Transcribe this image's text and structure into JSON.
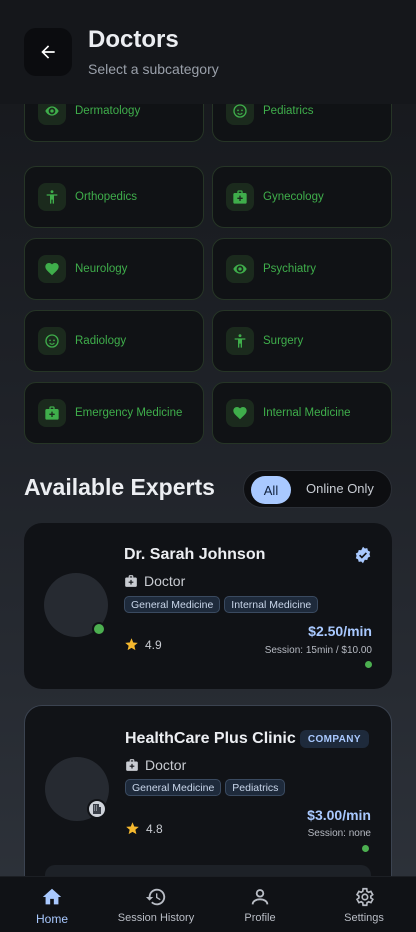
{
  "header": {
    "title": "Doctors",
    "subtitle": "Select a subcategory"
  },
  "categories": [
    {
      "label": "Dermatology",
      "icon": "face-icon"
    },
    {
      "label": "Pediatrics",
      "icon": "child-face-icon"
    },
    {
      "label": "Orthopedics",
      "icon": "person-icon"
    },
    {
      "label": "Gynecology",
      "icon": "medical-bag-icon"
    },
    {
      "label": "Neurology",
      "icon": "heart-icon"
    },
    {
      "label": "Psychiatry",
      "icon": "face-icon"
    },
    {
      "label": "Radiology",
      "icon": "child-face-icon"
    },
    {
      "label": "Surgery",
      "icon": "person-icon"
    },
    {
      "label": "Emergency Medicine",
      "icon": "medical-bag-icon"
    },
    {
      "label": "Internal Medicine",
      "icon": "heart-icon"
    }
  ],
  "experts_section": {
    "title": "Available Experts",
    "filter_all": "All",
    "filter_online": "Online Only"
  },
  "experts": [
    {
      "name": "Dr. Sarah Johnson",
      "role": "Doctor",
      "tags": [
        "General Medicine",
        "Internal Medicine"
      ],
      "rating": "4.9",
      "price": "$2.50/min",
      "session": "Session: 15min / $10.00"
    },
    {
      "name": "HealthCare Plus Clinic",
      "badge": "COMPANY",
      "role": "Doctor",
      "tags": [
        "General Medicine",
        "Pediatrics"
      ],
      "rating": "4.8",
      "price": "$3.00/min",
      "session": "Session: none"
    }
  ],
  "nav": [
    {
      "label": "Home",
      "icon": "home-icon"
    },
    {
      "label": "Session History",
      "icon": "history-icon"
    },
    {
      "label": "Profile",
      "icon": "person-outline-icon"
    },
    {
      "label": "Settings",
      "icon": "gear-icon"
    }
  ],
  "colors": {
    "accent": "#a9c9ff",
    "category_green": "#3fae4b",
    "online": "#4caf50"
  }
}
